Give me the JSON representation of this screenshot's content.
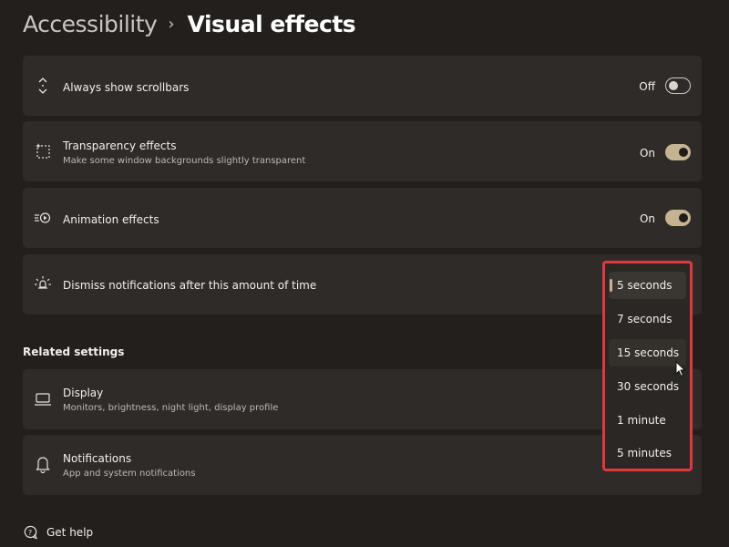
{
  "breadcrumb": {
    "parent": "Accessibility",
    "separator": "›",
    "current": "Visual effects"
  },
  "settings": [
    {
      "title": "Always show scrollbars",
      "subtitle": "",
      "state": "Off",
      "on": false,
      "icon": "scroll-arrows-icon"
    },
    {
      "title": "Transparency effects",
      "subtitle": "Make some window backgrounds slightly transparent",
      "state": "On",
      "on": true,
      "icon": "transparency-icon"
    },
    {
      "title": "Animation effects",
      "subtitle": "",
      "state": "On",
      "on": true,
      "icon": "animation-icon"
    },
    {
      "title": "Dismiss notifications after this amount of time",
      "subtitle": "",
      "icon": "notification-timer-icon"
    }
  ],
  "dismiss_dropdown": {
    "options": [
      "5 seconds",
      "7 seconds",
      "15 seconds",
      "30 seconds",
      "1 minute",
      "5 minutes"
    ],
    "selected": "5 seconds",
    "hovered": "15 seconds"
  },
  "related": {
    "title": "Related settings",
    "items": [
      {
        "title": "Display",
        "subtitle": "Monitors, brightness, night light, display profile",
        "icon": "monitor-icon"
      },
      {
        "title": "Notifications",
        "subtitle": "App and system notifications",
        "icon": "bell-icon"
      }
    ]
  },
  "help": {
    "label": "Get help",
    "icon": "help-chat-icon"
  },
  "colors": {
    "background": "#231f1c",
    "card": "#2f2b28",
    "accent": "#c6b392",
    "highlight_border": "#e0383d"
  }
}
